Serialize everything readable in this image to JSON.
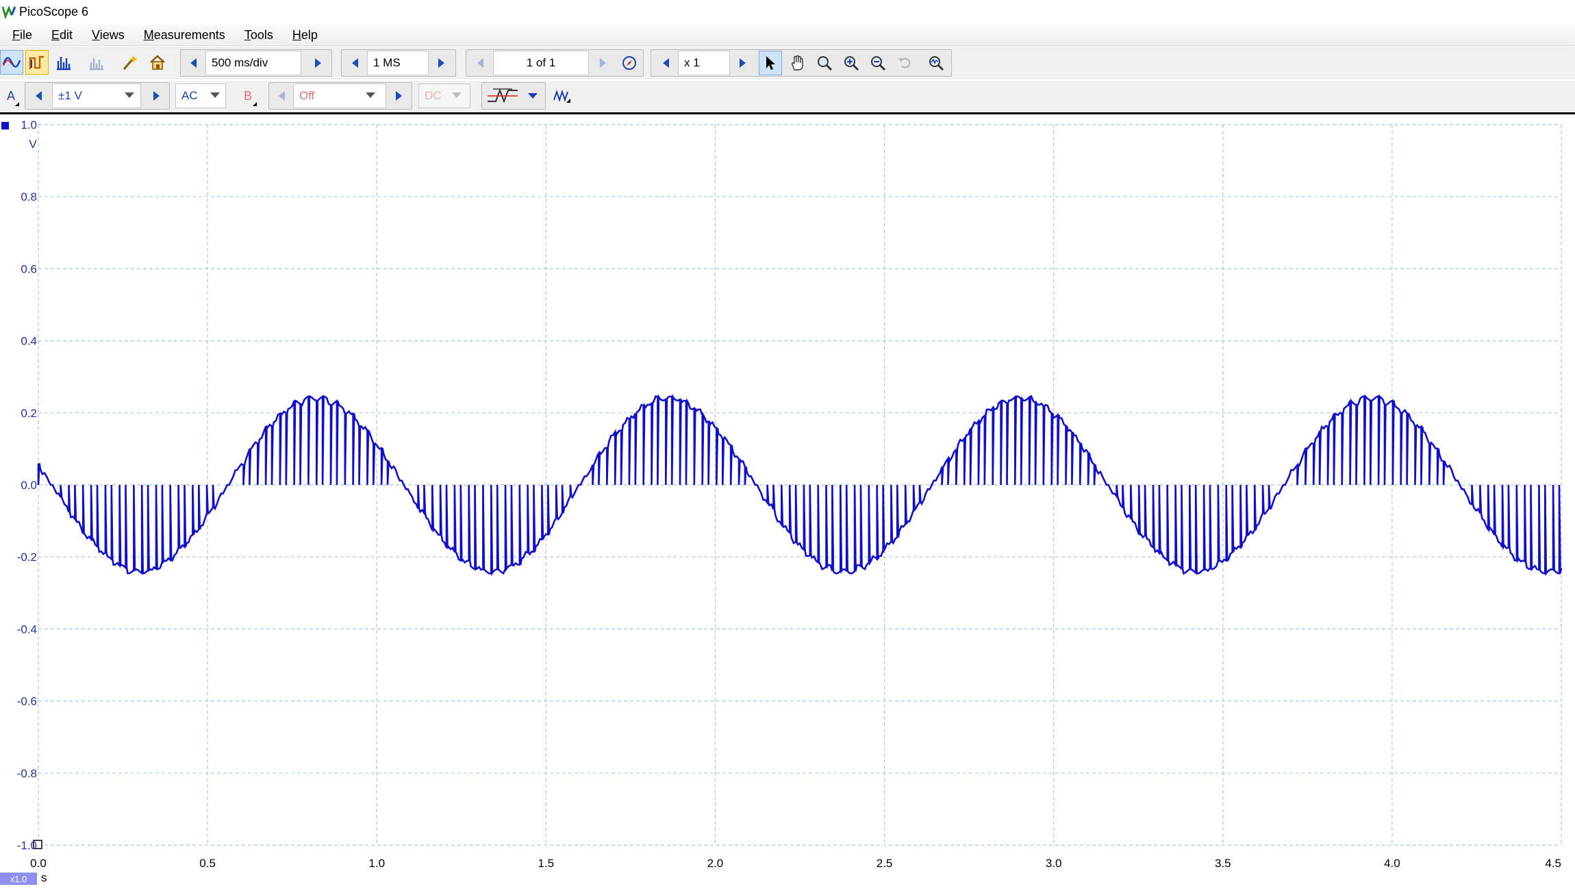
{
  "window": {
    "title": "PicoScope 6"
  },
  "menu": [
    {
      "prefix": "",
      "ul": "F",
      "rest": "ile"
    },
    {
      "prefix": "",
      "ul": "E",
      "rest": "dit"
    },
    {
      "prefix": "",
      "ul": "V",
      "rest": "iews"
    },
    {
      "prefix": "",
      "ul": "M",
      "rest": "easurements"
    },
    {
      "prefix": "",
      "ul": "T",
      "rest": "ools"
    },
    {
      "prefix": "",
      "ul": "H",
      "rest": "elp"
    }
  ],
  "toolbar1": {
    "timebase": "500 ms/div",
    "samples": "1 MS",
    "buffer": "1 of 1",
    "zoom": "x 1"
  },
  "toolbar2": {
    "channel_a_label": "A",
    "channel_a_range": "±1 V",
    "channel_a_coupling": "AC",
    "channel_b_label": "B",
    "channel_b_range": "Off",
    "channel_b_coupling": "DC"
  },
  "colors": {
    "trace": "#1010cc",
    "grid": "#a8c8d8",
    "axis_text": "#2233aa"
  },
  "icons": {
    "scope_mode": "sine-wave-icon",
    "persistence_mode": "persistence-icon",
    "spectrum_mode": "spectrum-icon",
    "spectrum_dim": "spectrum-dim-icon",
    "auto_setup": "wand-icon",
    "default_setup": "home-icon",
    "buffer_nav": "navigator-icon",
    "select_tool": "pointer-icon",
    "hand_tool": "hand-icon",
    "zoom_tool": "magnifier-icon",
    "zoom_in": "zoom-in-icon",
    "zoom_out": "zoom-out-icon",
    "undo_zoom": "undo-zoom-icon",
    "zoom_overview": "zoom-overview-icon",
    "trigger": "trigger-icon",
    "math": "math-channel-icon"
  },
  "chart_data": {
    "type": "line",
    "title": "",
    "xlabel": "",
    "ylabel": "",
    "x_unit": "s",
    "y_unit": "V",
    "xlim": [
      0.0,
      4.5
    ],
    "ylim": [
      -1.0,
      1.0
    ],
    "x_ticks": [
      "0.0",
      "0.5",
      "1.0",
      "1.5",
      "2.0",
      "2.5",
      "3.0",
      "3.5",
      "4.0",
      "4.5"
    ],
    "y_ticks": [
      "1.0",
      "0.8",
      "0.6",
      "0.4",
      "0.2",
      "0.0",
      "-0.2",
      "-0.4",
      "-0.6",
      "-0.8",
      "-1.0"
    ],
    "zoom_badge": "x1.0",
    "grid": true,
    "series": [
      {
        "channel": "A",
        "signal": {
          "kind": "stepped sine with spikes to zero",
          "amplitude_V": 0.24,
          "period_s": 1.04,
          "phase_zero_cross_rising_s": 0.56,
          "offset_V": 0.0
        },
        "x": [
          0.0,
          0.1,
          0.2,
          0.3,
          0.4,
          0.5,
          0.6,
          0.7,
          0.8,
          0.9,
          1.0,
          1.1,
          1.2,
          1.3,
          1.4,
          1.5,
          1.6,
          1.7,
          1.8,
          1.9,
          2.0,
          2.1,
          2.2,
          2.3,
          2.4,
          2.5,
          2.6,
          2.7,
          2.8,
          2.9,
          3.0,
          3.1,
          3.2,
          3.3,
          3.4,
          3.5,
          3.6,
          3.7,
          3.8,
          3.9,
          4.0,
          4.1,
          4.2,
          4.3,
          4.4,
          4.5
        ],
        "values": [
          0.09,
          -0.05,
          -0.18,
          -0.24,
          -0.22,
          -0.13,
          -0.02,
          0.11,
          0.21,
          0.24,
          0.18,
          0.07,
          -0.06,
          -0.18,
          -0.24,
          -0.21,
          -0.12,
          -0.01,
          0.12,
          0.21,
          0.23,
          0.17,
          0.05,
          -0.08,
          -0.19,
          -0.24,
          -0.21,
          -0.11,
          0.01,
          0.13,
          0.22,
          0.22,
          0.15,
          0.03,
          -0.09,
          -0.2,
          -0.24,
          -0.2,
          -0.1,
          0.02,
          0.15,
          0.22,
          0.21,
          0.14,
          0.0,
          -0.12
        ]
      }
    ]
  }
}
